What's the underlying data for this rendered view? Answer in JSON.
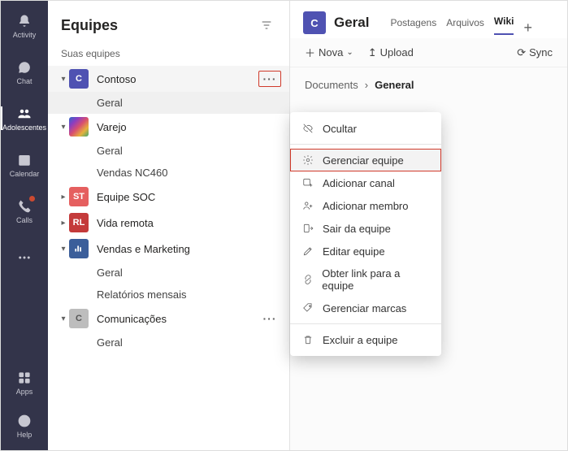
{
  "rail": {
    "activity": "Activity",
    "chat": "Chat",
    "teams": "Adolescentes",
    "calendar": "Calendar",
    "calls": "Calls",
    "apps": "Apps",
    "help": "Help"
  },
  "teams_pane": {
    "title": "Equipes",
    "section_label": "Suas equipes",
    "teams": [
      {
        "name": "Contoso",
        "initial": "C",
        "color": "#4f52b2",
        "channels": [
          "Geral"
        ],
        "expanded": true,
        "hover": true
      },
      {
        "name": "Varejo",
        "initial": "",
        "color": "#8f7cc2",
        "channels": [
          "Geral",
          "Vendas NC460"
        ],
        "expanded": true
      },
      {
        "name": "Equipe SOC",
        "initial": "ST",
        "color": "#e55f5f",
        "channels": [],
        "expanded": false
      },
      {
        "name": "Vida remota",
        "initial": "RL",
        "color": "#c43a3a",
        "channels": [],
        "expanded": false
      },
      {
        "name": "Vendas e Marketing",
        "initial": "",
        "color": "#3b5e9a",
        "channels": [
          "Geral",
          "Relatórios mensais"
        ],
        "expanded": true
      },
      {
        "name": "Comunicações",
        "initial": "C",
        "color": "#bdbdbd",
        "channels": [
          "Geral"
        ],
        "expanded": true,
        "show_more": true
      }
    ]
  },
  "main": {
    "channel_initial": "C",
    "channel_title": "Geral",
    "tabs": [
      "Postagens",
      "Arquivos",
      "Wiki"
    ],
    "active_tab": 2,
    "toolbar": {
      "new": "Nova",
      "upload": "Upload",
      "sync": "Sync"
    },
    "breadcrumb": {
      "root": "Documents",
      "current": "General"
    }
  },
  "context_menu": {
    "hide": "Ocultar",
    "manage": "Gerenciar equipe",
    "add_channel": "Adicionar canal",
    "add_member": "Adicionar membro",
    "leave": "Sair da equipe",
    "edit": "Editar equipe",
    "link": "Obter link para a equipe",
    "tags": "Gerenciar marcas",
    "delete": "Excluir a equipe"
  }
}
